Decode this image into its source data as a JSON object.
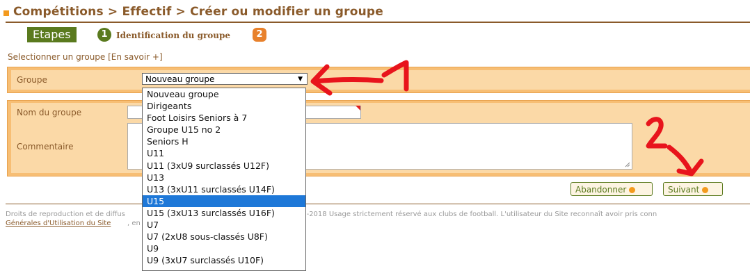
{
  "header": {
    "title": "Compétitions > Effectif > Créer ou modifier un groupe"
  },
  "steps": {
    "label": "Etapes",
    "step1_number": "1",
    "step1_text": "Identification du groupe",
    "step2_number": "2"
  },
  "select_group_help": "Selectionner un groupe [En savoir +]",
  "group_field": {
    "label": "Groupe",
    "selected_value": "Nouveau groupe",
    "arrow": "▼",
    "options": [
      "Nouveau groupe",
      "Dirigeants",
      "Foot Loisirs Seniors à 7",
      "Groupe U15 no 2",
      "Seniors H",
      "U11",
      "U11 (3xU9 surclassés U12F)",
      "U13",
      "U13 (3xU11 surclassés U14F)",
      "U15",
      "U15 (3xU13 surclassés U16F)",
      "U7",
      "U7 (2xU8 sous-classés U8F)",
      "U9",
      "U9 (3xU7 surclassés U10F)"
    ],
    "highlighted_option": "U15"
  },
  "form": {
    "name_label": "Nom du groupe",
    "name_value": "",
    "comment_label": "Commentaire",
    "comment_value": ""
  },
  "buttons": {
    "abandon": "Abandonner",
    "next": "Suivant"
  },
  "footer": {
    "text_left": "Droits de reproduction et de diffus",
    "text_right": "otball 1997-2018 Usage strictement réservé aux clubs de football. L'utilisateur du Site reconnaît avoir pris conn",
    "link": "Générales d'Utilisation du Site",
    "link_suffix": ", en"
  },
  "annotations": {
    "label_1": "1",
    "label_2": "2",
    "color": "#e8141c"
  },
  "colors": {
    "brand_brown": "#8a5a2a",
    "brand_green": "#5a7a1e",
    "panel_orange": "#f7be74",
    "accent_orange": "#f39a1e",
    "selection_blue": "#1e78d8"
  }
}
